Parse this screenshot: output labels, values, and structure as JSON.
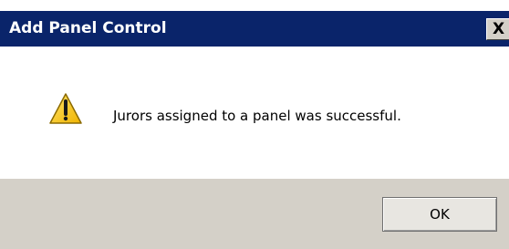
{
  "window": {
    "title": "Add Panel Control",
    "close_label": "X"
  },
  "dialog": {
    "icon": "warning-icon",
    "message": "Jurors assigned to a panel was successful.",
    "ok_label": "OK"
  },
  "colors": {
    "titlebar": "#0a246a",
    "title_text": "#ffffff",
    "content_background": "#ffffff",
    "footer_background": "#d4d0c8",
    "warning_yellow": "#f4c20d"
  }
}
